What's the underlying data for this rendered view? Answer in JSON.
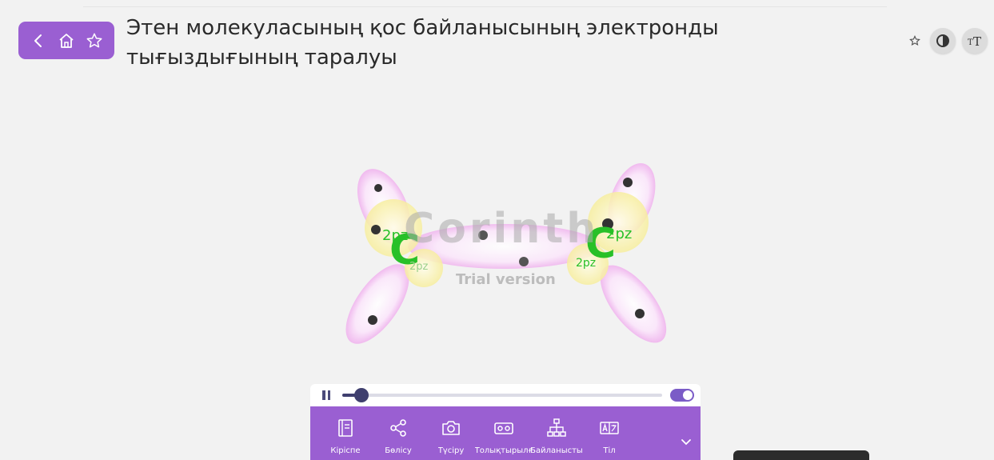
{
  "header": {
    "title": "Этен молекуласының қос байланысының электронды тығыздығының таралуы"
  },
  "nav": {
    "icons": [
      "back-icon",
      "home-icon",
      "star-icon"
    ]
  },
  "header_right": {
    "icons": [
      "star-icon",
      "contrast-icon",
      "text-size-icon"
    ]
  },
  "stage": {
    "atoms": {
      "left_carbon": "C",
      "right_carbon": "C"
    },
    "orbital_labels": {
      "left_upper": "2pz",
      "left_lower": "2pz",
      "right_upper": "2pz",
      "right_lower": "2pz"
    },
    "watermark": "Corinth",
    "trial": "Trial version"
  },
  "player": {
    "progress": 0.06
  },
  "toolbar": {
    "items": [
      {
        "label": "Кіріспе",
        "icon": "book-icon"
      },
      {
        "label": "Бөлісу",
        "icon": "share-icon"
      },
      {
        "label": "Түсіру",
        "icon": "camera-icon"
      },
      {
        "label": "Толықтырылғ",
        "icon": "vr-icon"
      },
      {
        "label": "Байланысты",
        "icon": "hierarchy-icon"
      },
      {
        "label": "Тіл",
        "icon": "language-icon"
      }
    ]
  },
  "colors": {
    "accent": "#9a5fd2",
    "carbon": "#28c028",
    "orbital_pink": "#f3b8f0",
    "orbital_yellow": "#fbf2a6"
  }
}
